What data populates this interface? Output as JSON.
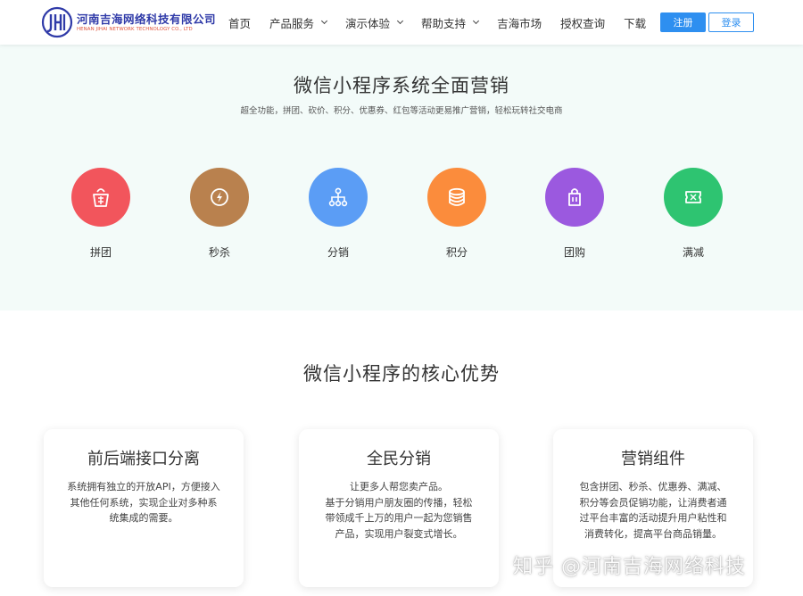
{
  "header": {
    "company_name": "河南吉海网络科技有限公司",
    "company_name_en": "HENAN JIHAI NETWORK TECHNOLOGY CO., LTD",
    "nav": [
      {
        "label": "首页",
        "has_dropdown": false
      },
      {
        "label": "产品服务",
        "has_dropdown": true
      },
      {
        "label": "演示体验",
        "has_dropdown": true
      },
      {
        "label": "帮助支持",
        "has_dropdown": true
      },
      {
        "label": "吉海市场",
        "has_dropdown": false
      },
      {
        "label": "授权查询",
        "has_dropdown": false
      },
      {
        "label": "下载",
        "has_dropdown": false
      }
    ],
    "register_label": "注册",
    "login_label": "登录"
  },
  "hero": {
    "title": "微信小程序系统全面营销",
    "subtitle": "超全功能，拼团、砍价、积分、优惠券、红包等活动更易推广营销，轻松玩转社交电商",
    "features": [
      {
        "label": "拼团",
        "icon": "group-buy-bag-icon",
        "color": "#f2555c"
      },
      {
        "label": "秒杀",
        "icon": "lightning-icon",
        "color": "#b9814e"
      },
      {
        "label": "分销",
        "icon": "network-tree-icon",
        "color": "#5b9df5"
      },
      {
        "label": "积分",
        "icon": "coin-stack-icon",
        "color": "#fb8c3c"
      },
      {
        "label": "团购",
        "icon": "shopping-bag-icon",
        "color": "#9b59df"
      },
      {
        "label": "满减",
        "icon": "ticket-icon",
        "color": "#2ec471"
      }
    ]
  },
  "advantages": {
    "title": "微信小程序的核心优势",
    "cards": [
      {
        "title": "前后端接口分离",
        "lines": [
          "系统拥有独立的开放API，方便接入",
          "其他任何系统，实现企业对多种系",
          "统集成的需要。"
        ]
      },
      {
        "title": "全民分销",
        "lines": [
          "让更多人帮您卖产品。",
          "基于分销用户朋友圈的传播，轻松",
          "带领成千上万的用户一起为您销售",
          "产品，实现用户裂变式增长。"
        ]
      },
      {
        "title": "营销组件",
        "lines": [
          "包含拼团、秒杀、优惠券、满减、",
          "积分等会员促销功能，让消费者通",
          "过平台丰富的活动提升用户粘性和",
          "消费转化，提高平台商品销量。"
        ]
      }
    ]
  },
  "watermark": "知乎 @河南吉海网络科技"
}
